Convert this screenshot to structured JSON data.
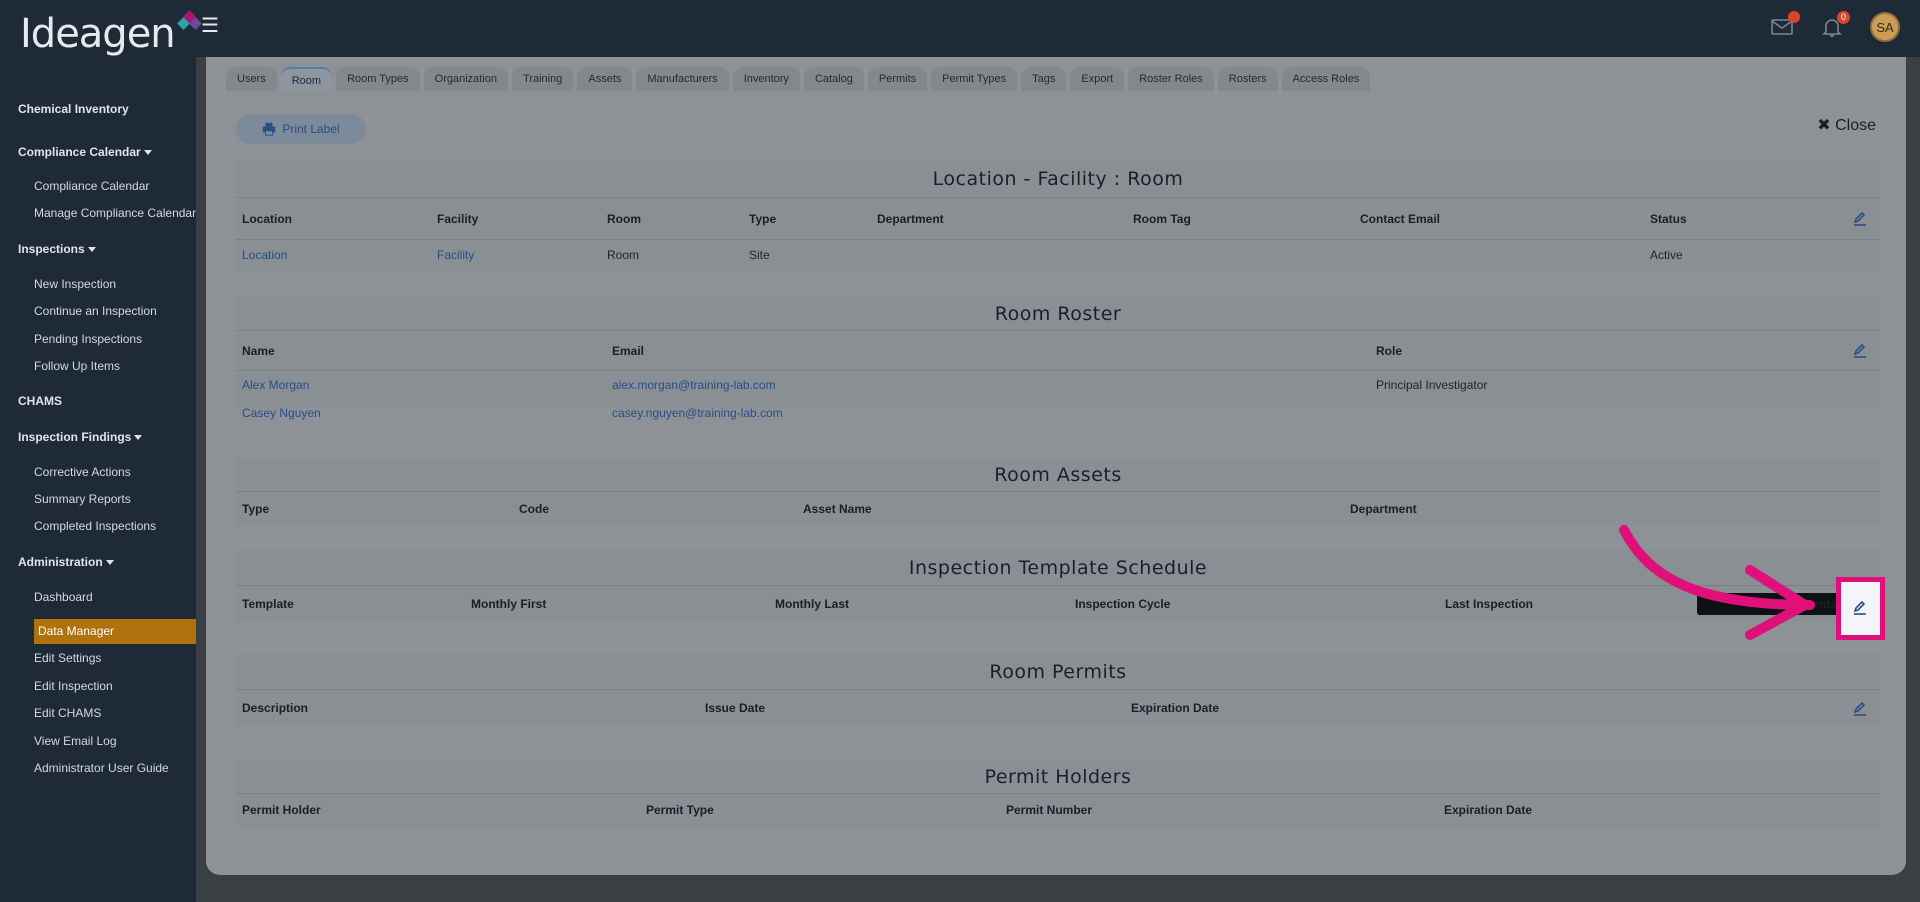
{
  "brand": {
    "logo_text": "Ideagen"
  },
  "topbar": {
    "mail_icon": "mail-icon",
    "notifications_icon": "bell-icon",
    "notifications_count": "0",
    "avatar_initials": "SA"
  },
  "sidebar": {
    "chemical_inventory": "Chemical Inventory",
    "compliance_calendar_head": "Compliance Calendar",
    "compliance_calendar": "Compliance Calendar",
    "manage_compliance_calendar": "Manage Compliance Calendar",
    "inspections_head": "Inspections",
    "new_inspection": "New Inspection",
    "continue_inspection": "Continue an Inspection",
    "pending_inspections": "Pending Inspections",
    "follow_up_items": "Follow Up Items",
    "chams": "CHAMS",
    "inspection_findings_head": "Inspection Findings",
    "corrective_actions": "Corrective Actions",
    "summary_reports": "Summary Reports",
    "completed_inspections": "Completed Inspections",
    "administration_head": "Administration",
    "dashboard": "Dashboard",
    "data_manager": "Data Manager",
    "edit_settings": "Edit Settings",
    "edit_inspection": "Edit Inspection",
    "edit_chams": "Edit CHAMS",
    "view_email_log": "View Email Log",
    "admin_user_guide": "Administrator User Guide"
  },
  "tabs": [
    "Users",
    "Room",
    "Room Types",
    "Organization",
    "Training",
    "Assets",
    "Manufacturers",
    "Inventory",
    "Catalog",
    "Permits",
    "Permit Types",
    "Tags",
    "Export",
    "Roster Roles",
    "Rosters",
    "Access Roles"
  ],
  "actions": {
    "print_label": "Print Label",
    "close": "Close"
  },
  "location": {
    "title": "Location - Facility : Room",
    "headers": [
      "Location",
      "Facility",
      "Room",
      "Type",
      "Department",
      "Room Tag",
      "Contact Email",
      "Status"
    ],
    "row": [
      "Location",
      "Facility",
      "Room",
      "Site",
      "",
      "",
      "",
      "Active"
    ]
  },
  "roster": {
    "title": "Room Roster",
    "headers": [
      "Name",
      "Email",
      "Role"
    ],
    "rows": [
      [
        "Alex Morgan",
        "alex.morgan@training-lab.com",
        "Principal Investigator"
      ],
      [
        "Casey Nguyen",
        "casey.nguyen@training-lab.com",
        ""
      ]
    ]
  },
  "assets": {
    "title": "Room Assets",
    "headers": [
      "Type",
      "Code",
      "Asset Name",
      "Department"
    ]
  },
  "schedule": {
    "title": "Inspection Template Schedule",
    "headers": [
      "Template",
      "Monthly First",
      "Monthly Last",
      "Inspection Cycle",
      "Last Inspection"
    ],
    "tooltip": "signments"
  },
  "permits": {
    "title": "Room Permits",
    "headers": [
      "Description",
      "Issue Date",
      "Expiration Date"
    ]
  },
  "holders": {
    "title": "Permit Holders",
    "headers": [
      "Permit Holder",
      "Permit Type",
      "Permit Number",
      "Expiration Date"
    ]
  },
  "colors": {
    "highlight": "#e0107a",
    "active_nav": "#b0720f",
    "link": "#234f88"
  }
}
